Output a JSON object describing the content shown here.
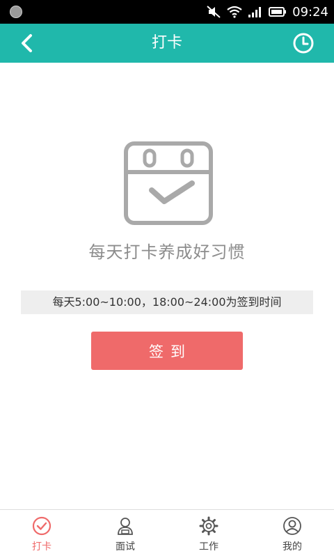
{
  "status_bar": {
    "time": "09:24"
  },
  "header": {
    "title": "打卡"
  },
  "main": {
    "slogan": "每天打卡养成好习惯",
    "time_notice": "每天5:00~10:00，18:00~24:00为签到时间",
    "checkin_button_label": "签到"
  },
  "bottom_nav": {
    "items": [
      {
        "label": "打卡",
        "icon": "check-circle-icon",
        "active": true
      },
      {
        "label": "面试",
        "icon": "interviewer-icon",
        "active": false
      },
      {
        "label": "工作",
        "icon": "gear-icon",
        "active": false
      },
      {
        "label": "我的",
        "icon": "user-icon",
        "active": false
      }
    ]
  },
  "colors": {
    "header_bg": "#20b8ab",
    "accent_red": "#ef6a6a",
    "icon_gray": "#a9a9a9"
  }
}
